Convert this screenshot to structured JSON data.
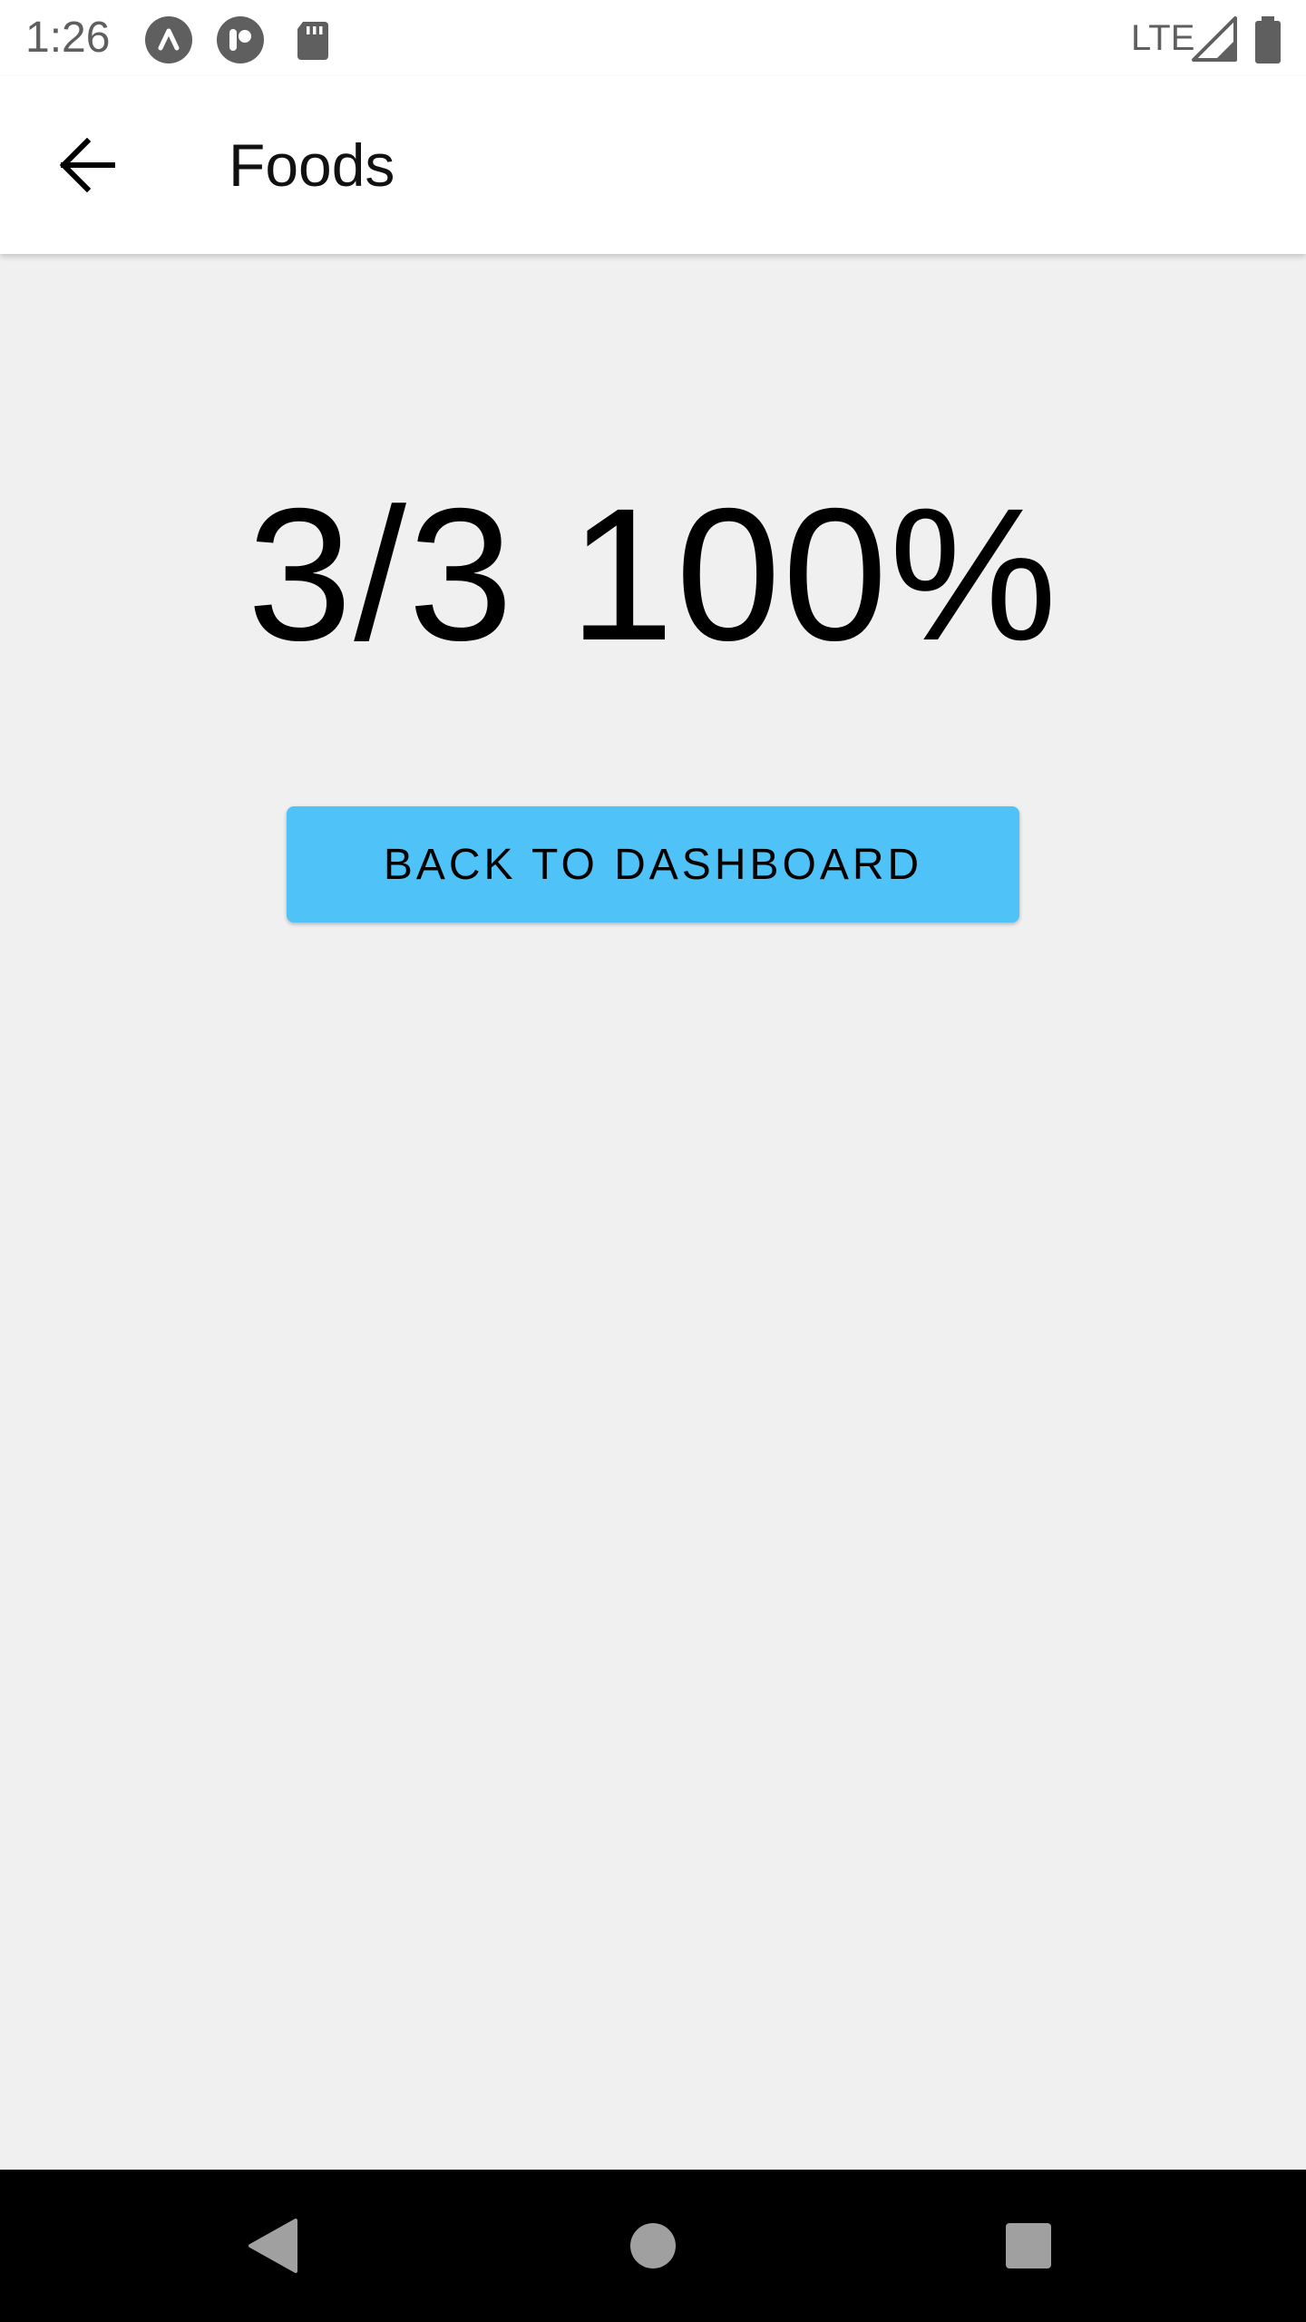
{
  "status_bar": {
    "time": "1:26",
    "network": "LTE",
    "icons": [
      "assistant-icon",
      "notification-app-icon",
      "sd-card-icon",
      "signal-icon",
      "battery-icon"
    ]
  },
  "app_bar": {
    "title": "Foods",
    "back_icon": "arrow-back-icon"
  },
  "result": {
    "score_text": "3/3 100%"
  },
  "actions": {
    "back_to_dashboard_label": "BACK TO DASHBOARD"
  },
  "navigation": {
    "icons": [
      "nav-back-icon",
      "nav-home-icon",
      "nav-recents-icon"
    ]
  },
  "colors": {
    "accent": "#4fc3f7",
    "background": "#f0f0f0",
    "app_bar": "#ffffff",
    "nav_bar": "#000000"
  }
}
